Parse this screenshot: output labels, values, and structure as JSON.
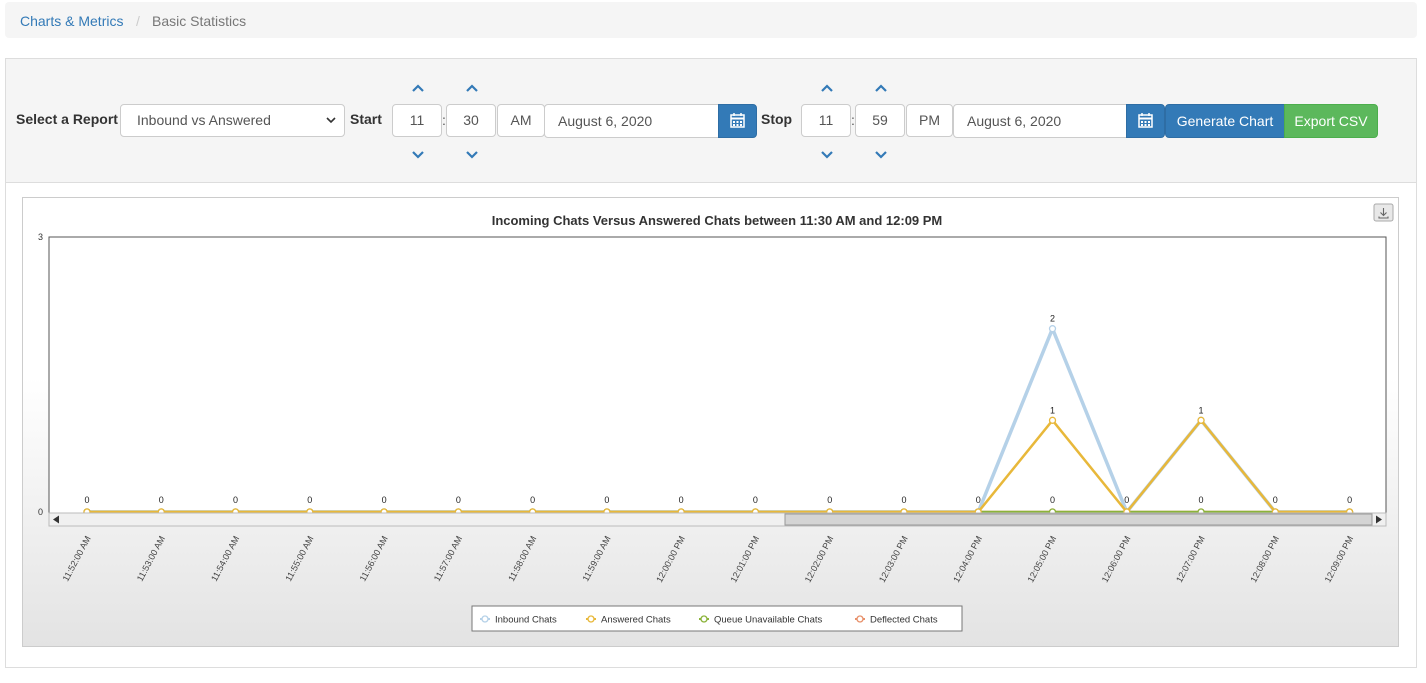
{
  "breadcrumb": {
    "parent": "Charts & Metrics",
    "separator": "/",
    "current": "Basic Statistics"
  },
  "toolbar": {
    "select_label": "Select a Report",
    "report_selected": "Inbound vs Answered",
    "start_label": "Start",
    "start_hour": "11",
    "start_minute": "30",
    "start_ampm": "AM",
    "start_date": "August 6, 2020",
    "stop_label": "Stop",
    "stop_hour": "11",
    "stop_minute": "59",
    "stop_ampm": "PM",
    "stop_date": "August 6, 2020",
    "time_separator": ":",
    "generate_label": "Generate Chart",
    "export_label": "Export CSV"
  },
  "colors": {
    "primary": "#337ab7",
    "success": "#5cb85c",
    "inbound": "#b5d1e8",
    "answered": "#e8b83a",
    "queue_unavailable": "#8bb33a",
    "deflected": "#e8906a"
  },
  "chart_data": {
    "type": "line",
    "title": "Incoming Chats Versus Answered Chats between 11:30 AM and 12:09 PM",
    "x": [
      "11:52:00 AM",
      "11:53:00 AM",
      "11:54:00 AM",
      "11:55:00 AM",
      "11:56:00 AM",
      "11:57:00 AM",
      "11:58:00 AM",
      "11:59:00 AM",
      "12:00:00 PM",
      "12:01:00 PM",
      "12:02:00 PM",
      "12:03:00 PM",
      "12:04:00 PM",
      "12:05:00 PM",
      "12:06:00 PM",
      "12:07:00 PM",
      "12:08:00 PM",
      "12:09:00 PM"
    ],
    "ylim": [
      0,
      3
    ],
    "yticks": [
      "0",
      "3"
    ],
    "series": [
      {
        "name": "Inbound Chats",
        "color": "#b5d1e8",
        "values": [
          0,
          0,
          0,
          0,
          0,
          0,
          0,
          0,
          0,
          0,
          0,
          0,
          0,
          2,
          0,
          1,
          0,
          0
        ]
      },
      {
        "name": "Answered Chats",
        "color": "#e8b83a",
        "values": [
          0,
          0,
          0,
          0,
          0,
          0,
          0,
          0,
          0,
          0,
          0,
          0,
          0,
          1,
          0,
          1,
          0,
          0
        ]
      },
      {
        "name": "Queue Unavailable Chats",
        "color": "#8bb33a",
        "values": [
          0,
          0,
          0,
          0,
          0,
          0,
          0,
          0,
          0,
          0,
          0,
          0,
          0,
          0,
          0,
          0,
          0,
          0
        ]
      },
      {
        "name": "Deflected Chats",
        "color": "#e8906a",
        "values": [
          0,
          0,
          0,
          0,
          0,
          0,
          0,
          0,
          0,
          0,
          0,
          0,
          0,
          0,
          0,
          0,
          0,
          0
        ]
      }
    ],
    "data_labels": [
      "0",
      "0",
      "0",
      "0",
      "0",
      "0",
      "0",
      "0",
      "0",
      "0",
      "0",
      "0",
      "0",
      "0",
      "0",
      "0",
      "0",
      "0"
    ],
    "peak_labels": [
      {
        "x_index": 13,
        "value": 2,
        "text": "2"
      },
      {
        "x_index": 13,
        "value": 1,
        "text": "1"
      },
      {
        "x_index": 15,
        "value": 1,
        "text": "1"
      }
    ],
    "legend_position": "bottom",
    "grid": false
  }
}
